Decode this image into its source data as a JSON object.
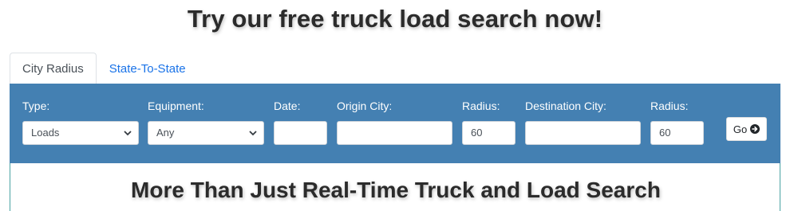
{
  "headline": "Try our free truck load search now!",
  "tabs": [
    {
      "label": "City Radius",
      "active": true
    },
    {
      "label": "State-To-State",
      "active": false
    }
  ],
  "form": {
    "type": {
      "label": "Type:",
      "value": "Loads"
    },
    "equipment": {
      "label": "Equipment:",
      "value": "Any"
    },
    "date": {
      "label": "Date:",
      "value": ""
    },
    "origin_city": {
      "label": "Origin City:",
      "value": ""
    },
    "origin_radius": {
      "label": "Radius:",
      "value": "60"
    },
    "destination_city": {
      "label": "Destination City:",
      "value": ""
    },
    "destination_radius": {
      "label": "Radius:",
      "value": "60"
    },
    "go_label": "Go"
  },
  "section_title": "More Than Just Real-Time Truck and Load Search",
  "colors": {
    "panel": "#4480b2",
    "tab_link": "#1a73e8",
    "card_border": "#4aa3a3"
  },
  "icons": {
    "select_arrow": "chevron-down-icon",
    "go": "arrow-circle-right-icon"
  }
}
